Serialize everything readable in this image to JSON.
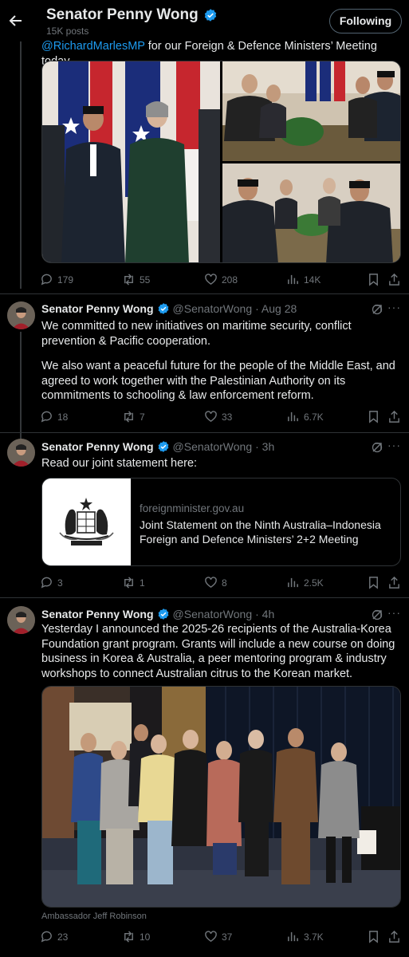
{
  "header": {
    "name": "Senator Penny Wong",
    "posts": "15K posts",
    "following_label": "Following"
  },
  "tweet0": {
    "text_mention": "@RichardMarlesMP",
    "text_rest": " for our Foreign & Defence Ministers’ Meeting today.",
    "stats": {
      "replies": "179",
      "reposts": "55",
      "likes": "208",
      "views": "14K"
    }
  },
  "tweet1": {
    "name": "Senator Penny Wong",
    "handle": "@SenatorWong",
    "time": "· Aug 28",
    "para1": "We committed to new initiatives on maritime security, conflict prevention & Pacific cooperation.",
    "para2": "We also want a peaceful future for the people of the Middle East, and agreed to work together with the Palestinian Authority on its commitments to schooling & law enforcement reform.",
    "stats": {
      "replies": "18",
      "reposts": "7",
      "likes": "33",
      "views": "6.7K"
    }
  },
  "tweet2": {
    "name": "Senator Penny Wong",
    "handle": "@SenatorWong",
    "time": "· 3h",
    "text": "Read our joint statement here:",
    "card": {
      "domain": "foreignminister.gov.au",
      "title": "Joint Statement on the Ninth Australia–Indonesia Foreign and Defence Ministers’ 2+2 Meeting"
    },
    "stats": {
      "replies": "3",
      "reposts": "1",
      "likes": "8",
      "views": "2.5K"
    }
  },
  "tweet3": {
    "name": "Senator Penny Wong",
    "handle": "@SenatorWong",
    "time": "· 4h",
    "text": "Yesterday I announced the 2025-26 recipients of the Australia-Korea Foundation grant program. Grants will include a new course on doing business in Korea & Australia, a peer mentoring program & industry workshops to connect Australian citrus to the Korean market.",
    "caption": "Ambassador Jeff Robinson",
    "stats": {
      "replies": "23",
      "reposts": "10",
      "likes": "37",
      "views": "3.7K"
    }
  },
  "icons": {
    "back": "back-arrow-icon",
    "verified": "verified-badge-icon",
    "grok": "grok-icon",
    "more": "more-icon",
    "reply": "reply-icon",
    "repost": "repost-icon",
    "like": "like-icon",
    "views": "views-icon",
    "bookmark": "bookmark-icon",
    "share": "share-icon"
  },
  "colors": {
    "background": "#000000",
    "text": "#e7e9ea",
    "secondary": "#71767b",
    "link": "#1d9bf0",
    "verified": "#1d9bf0",
    "border": "#2f3336"
  }
}
